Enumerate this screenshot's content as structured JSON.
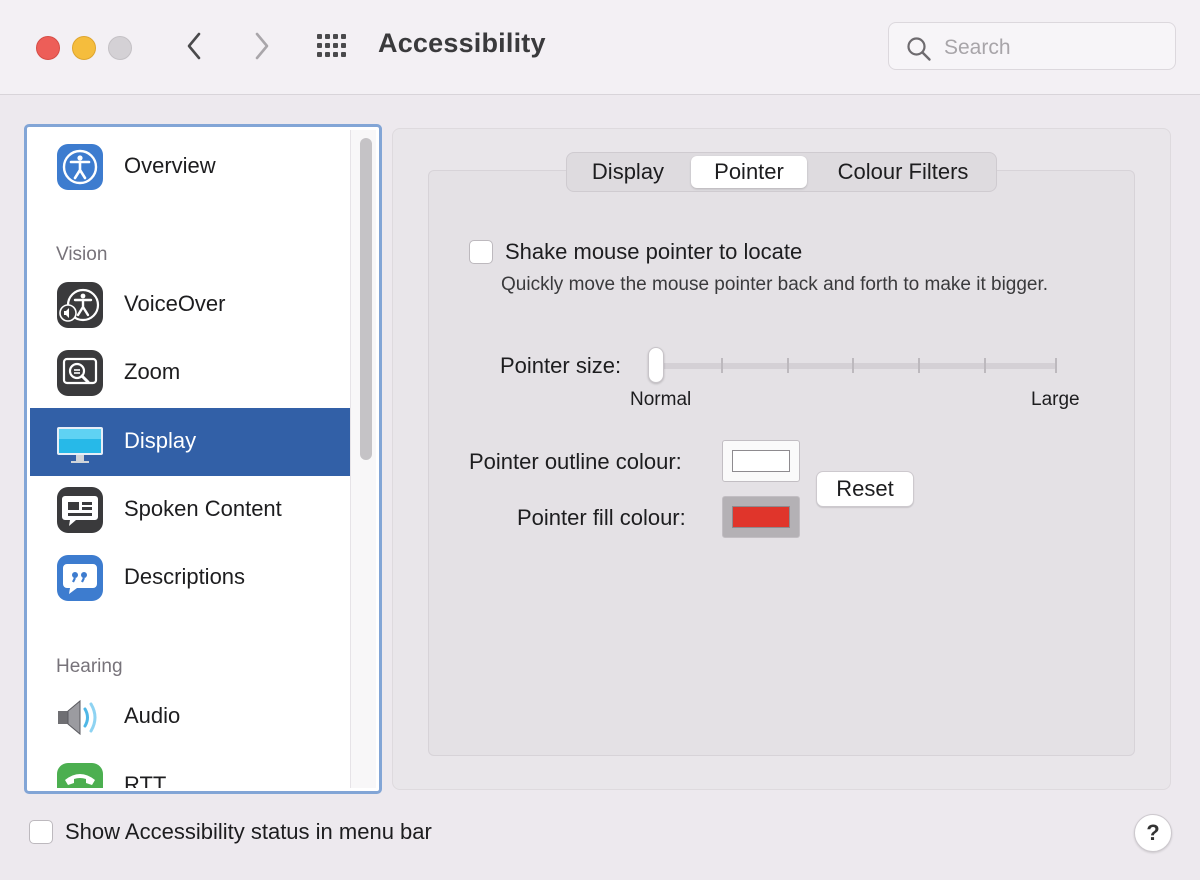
{
  "window": {
    "title": "Accessibility",
    "search_placeholder": "Search"
  },
  "sidebar": {
    "items": [
      {
        "label": "Overview",
        "icon": "accessibility-person-icon"
      },
      {
        "label": "VoiceOver",
        "icon": "voiceover-icon"
      },
      {
        "label": "Zoom",
        "icon": "zoom-icon"
      },
      {
        "label": "Display",
        "icon": "display-monitor-icon",
        "selected": true
      },
      {
        "label": "Spoken Content",
        "icon": "speech-bubble-icon"
      },
      {
        "label": "Descriptions",
        "icon": "quote-bubble-icon"
      },
      {
        "label": "Audio",
        "icon": "speaker-icon"
      },
      {
        "label": "RTT",
        "icon": "phone-icon"
      }
    ],
    "sections": {
      "vision": "Vision",
      "hearing": "Hearing"
    }
  },
  "tabs": [
    {
      "label": "Display"
    },
    {
      "label": "Pointer",
      "selected": true
    },
    {
      "label": "Colour Filters"
    }
  ],
  "pointer": {
    "shake_label": "Shake mouse pointer to locate",
    "shake_checked": false,
    "shake_description": "Quickly move the mouse pointer back and forth to make it bigger.",
    "size_label": "Pointer size:",
    "size_min_label": "Normal",
    "size_max_label": "Large",
    "size_value": 0,
    "outline_label": "Pointer outline colour:",
    "outline_color": "#ffffff",
    "fill_label": "Pointer fill colour:",
    "fill_color": "#e0352b",
    "reset_label": "Reset"
  },
  "footer": {
    "status_menu_label": "Show Accessibility status in menu bar",
    "status_menu_checked": false,
    "help_label": "?"
  },
  "colors": {
    "selection": "#3260a7",
    "sidebar_focus_ring": "#82a5d6"
  }
}
